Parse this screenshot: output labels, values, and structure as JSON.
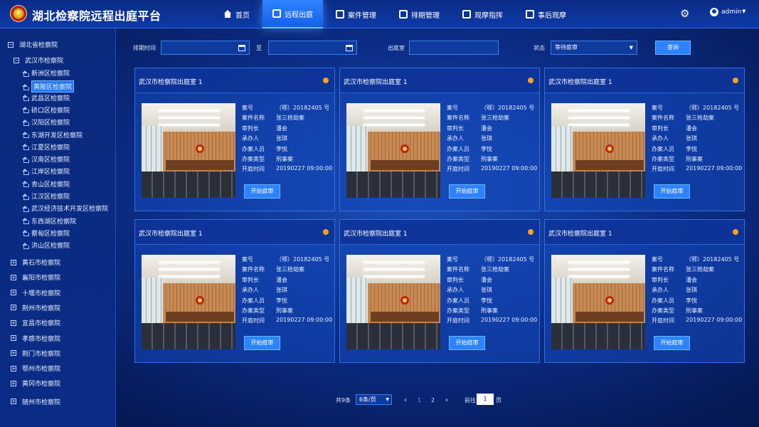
{
  "app": {
    "title": "湖北检察院远程出庭平台",
    "user": "admin"
  },
  "nav": [
    {
      "label": "首页",
      "icon": "home-icon"
    },
    {
      "label": "远程出庭",
      "icon": "monitor-icon",
      "active": true
    },
    {
      "label": "案件管理",
      "icon": "case-icon"
    },
    {
      "label": "排期管理",
      "icon": "calendar-icon"
    },
    {
      "label": "观摩指挥",
      "icon": "command-icon"
    },
    {
      "label": "事后观摩",
      "icon": "replay-icon"
    }
  ],
  "tree": {
    "root": "湖北省检察院",
    "wuhan": "武汉市检察院",
    "wuhan_children": [
      "新洲区检察院",
      "黄陂区检察院",
      "武昌区检察院",
      "硚口区检察院",
      "汉阳区检察院",
      "东湖开发区检察院",
      "江夏区检察院",
      "汉南区检察院",
      "江岸区检察院",
      "青山区检察院",
      "江汉区检察院",
      "武汉经济技术开发区检察院",
      "东西湖区检察院",
      "蔡甸区检察院",
      "洪山区检察院"
    ],
    "selected": "黄陂区检察院",
    "others": [
      "黄石市检察院",
      "襄阳市检察院",
      "十堰市检察院",
      "荆州市检察院",
      "宜昌市检察院",
      "孝感市检察院",
      "荆门市检察院",
      "鄂州市检察院",
      "黄冈市检察院",
      "随州市检察院"
    ]
  },
  "filters": {
    "time_label": "排期时间",
    "to_label": "至",
    "room_label": "出庭室",
    "status_label": "状态",
    "status_value": "等待庭审",
    "query_button": "查询"
  },
  "card_labels": {
    "case_no": "案号",
    "case_name": "案件名称",
    "judge": "审判长",
    "handler": "承办人",
    "assistant": "办案人员",
    "type": "办案类型",
    "time": "开庭时间",
    "start_button": "开始庭审"
  },
  "cards": [
    {
      "title": "武汉市检察院出庭室 1",
      "status_color": "#f6a21c",
      "case_no": "（鄂）20182405 号",
      "case_name": "张三抢劫案",
      "judge": "潘会",
      "handler": "张琪",
      "assistant": "李悦",
      "type": "刑事案",
      "time": "20190227  09:00:00"
    },
    {
      "title": "武汉市检察院出庭室 1",
      "status_color": "#f6a21c",
      "case_no": "（鄂）20182405 号",
      "case_name": "张三抢劫案",
      "judge": "潘会",
      "handler": "张琪",
      "assistant": "李悦",
      "type": "刑事案",
      "time": "20190227  09:00:00"
    },
    {
      "title": "武汉市检察院出庭室 1",
      "status_color": "#f6a21c",
      "case_no": "（鄂）20182405 号",
      "case_name": "张三抢劫案",
      "judge": "潘会",
      "handler": "张琪",
      "assistant": "李悦",
      "type": "刑事案",
      "time": "20190227  09:00:00"
    },
    {
      "title": "武汉市检察院出庭室 1",
      "status_color": "#f6a21c",
      "case_no": "（鄂）20182405 号",
      "case_name": "张三抢劫案",
      "judge": "潘会",
      "handler": "张琪",
      "assistant": "李悦",
      "type": "刑事案",
      "time": "20190227  09:00:00"
    },
    {
      "title": "武汉市检察院出庭室 1",
      "status_color": "#f6a21c",
      "case_no": "（鄂）20182405 号",
      "case_name": "张三抢劫案",
      "judge": "潘会",
      "handler": "张琪",
      "assistant": "李悦",
      "type": "刑事案",
      "time": "20190227  09:00:00"
    },
    {
      "title": "武汉市检察院出庭室 1",
      "status_color": "#f6a21c",
      "case_no": "（鄂）20182405 号",
      "case_name": "张三抢劫案",
      "judge": "潘会",
      "handler": "张琪",
      "assistant": "李悦",
      "type": "刑事案",
      "time": "20190227  09:00:00"
    }
  ],
  "pagination": {
    "total": "共9条",
    "page_size": "6条/页",
    "pages": [
      "1",
      "2"
    ],
    "current": "1",
    "goto_label": "前往",
    "goto_value": "1",
    "page_suffix": "页"
  }
}
